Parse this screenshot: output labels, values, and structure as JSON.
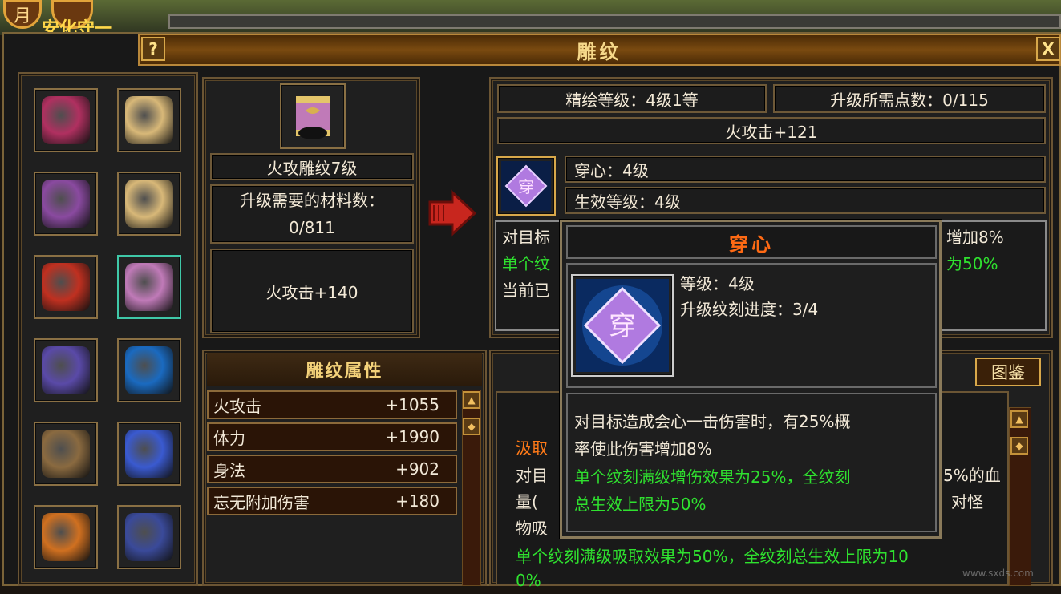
{
  "window": {
    "title": "雕纹",
    "help_label": "?",
    "close_label": "X"
  },
  "top_bar": {
    "left_glyph": "月",
    "left_text": "安化守一"
  },
  "item_slots": [
    {
      "name": "slot-wings",
      "selected": false
    },
    {
      "name": "slot-ring-1",
      "selected": false
    },
    {
      "name": "slot-armor",
      "selected": false
    },
    {
      "name": "slot-ring-2",
      "selected": false
    },
    {
      "name": "slot-talisman",
      "selected": false
    },
    {
      "name": "slot-bracer",
      "selected": true
    },
    {
      "name": "slot-amulet",
      "selected": false
    },
    {
      "name": "slot-needle",
      "selected": false
    },
    {
      "name": "slot-belt",
      "selected": false
    },
    {
      "name": "slot-gloves",
      "selected": false
    },
    {
      "name": "slot-weapon",
      "selected": false
    },
    {
      "name": "slot-boots",
      "selected": false
    }
  ],
  "engraving": {
    "name": "火攻雕纹7级",
    "upgrade_material_label": "升级需要的材料数：",
    "upgrade_material_value": "0/811",
    "current_effect": "火攻击+140"
  },
  "refine": {
    "level": "精绘等级：4级1等",
    "points": "升级所需点数：0/115",
    "bonus": "火攻击+121",
    "gem_name": "穿心：4级",
    "gem_effect_level": "生效等级：4级",
    "desc_line1_left": "对目标",
    "desc_line1_right": "增加8%",
    "desc_line2_left": "单个纹",
    "desc_line2_right": "为50%",
    "desc_line3_left": "当前已"
  },
  "attributes": {
    "title": "雕纹属性",
    "rows": [
      {
        "name": "火攻击",
        "value": "+1055"
      },
      {
        "name": "体力",
        "value": "+1990"
      },
      {
        "name": "身法",
        "value": "+902"
      },
      {
        "name": "忘无附加伤害",
        "value": "+180"
      }
    ]
  },
  "lower_right": {
    "catalog_button": "图鉴",
    "title_partial": "汲取",
    "line1_left": "对目",
    "line1_right": "5%的血",
    "line2_left": "量(",
    "line2_right": "对怪",
    "line3_left": "物吸",
    "green_line": "单个纹刻满级吸取效果为50%，全纹刻总生效上限为10",
    "green_line2": "0%"
  },
  "tooltip": {
    "title": "穿心",
    "gem_glyph": "穿",
    "level": "等级：4级",
    "progress": "升级纹刻进度：3/4",
    "desc1": "对目标造成会心一击伤害时，有25%概",
    "desc2": "率使此伤害增加8%",
    "green1": "单个纹刻满级增伤效果为25%，全纹刻",
    "green2": "总生效上限为50%"
  },
  "watermark": "www.sxds.com"
}
